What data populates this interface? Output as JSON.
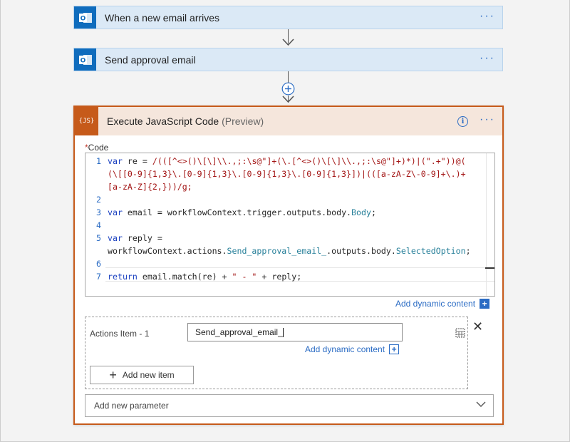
{
  "steps": [
    {
      "title": "When a new email arrives",
      "icon": "outlook-icon"
    },
    {
      "title": "Send approval email",
      "icon": "outlook-icon"
    }
  ],
  "menu_label": "···",
  "action": {
    "title": "Execute JavaScript Code",
    "badge": "(Preview)",
    "icon": "{JS}",
    "info": "i",
    "code_label": "Code",
    "required_mark": "*",
    "code_lines": [
      {
        "n": "1",
        "tokens": [
          {
            "t": "var",
            "c": "kw"
          },
          {
            "t": " re = ",
            "c": ""
          },
          {
            "t": "/(([^<>()\\[\\]\\\\.,;:\\s@\"]+(\\.[^<>()\\[\\]\\\\.,;:\\s@\"]+)*)|(\".+\"))@(",
            "c": "str"
          }
        ]
      },
      {
        "n": "",
        "tokens": [
          {
            "t": "(\\[[0-9]{1,3}\\.[0-9]{1,3}\\.[0-9]{1,3}\\.[0-9]{1,3}])|(([a-zA-Z\\-0-9]+\\.)+",
            "c": "str"
          }
        ]
      },
      {
        "n": "",
        "tokens": [
          {
            "t": "[a-zA-Z]{2,}))/g;",
            "c": "str"
          }
        ]
      },
      {
        "n": "2",
        "tokens": []
      },
      {
        "n": "3",
        "tokens": [
          {
            "t": "var",
            "c": "kw"
          },
          {
            "t": " email = workflowContext.trigger.outputs.body.",
            "c": ""
          },
          {
            "t": "Body",
            "c": "id"
          },
          {
            "t": ";",
            "c": ""
          }
        ]
      },
      {
        "n": "4",
        "tokens": []
      },
      {
        "n": "5",
        "tokens": [
          {
            "t": "var",
            "c": "kw"
          },
          {
            "t": " reply =",
            "c": ""
          }
        ]
      },
      {
        "n": "",
        "tokens": [
          {
            "t": "workflowContext.actions.",
            "c": ""
          },
          {
            "t": "Send_approval_email_",
            "c": "id"
          },
          {
            "t": ".outputs.body.",
            "c": ""
          },
          {
            "t": "SelectedOption",
            "c": "id"
          },
          {
            "t": ";",
            "c": ""
          }
        ]
      },
      {
        "n": "6",
        "tokens": []
      },
      {
        "n": "7",
        "tokens": [
          {
            "t": "return",
            "c": "kw"
          },
          {
            "t": " email.match(re) + ",
            "c": ""
          },
          {
            "t": "\" - \"",
            "c": "str"
          },
          {
            "t": " + reply;",
            "c": ""
          }
        ]
      }
    ],
    "add_dynamic_label": "Add dynamic content",
    "actions_item_label": "Actions Item - 1",
    "actions_item_value": "Send_approval_email_",
    "add_item_label": "Add new item",
    "add_param_label": "Add new parameter"
  },
  "colors": {
    "accent": "#2b6cc4",
    "action_border": "#c65a1a",
    "trigger_blue": "#0f6cbd"
  }
}
